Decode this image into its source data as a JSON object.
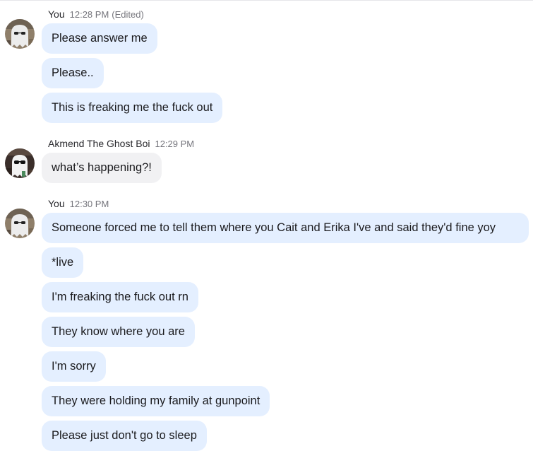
{
  "colors": {
    "mine_bubble": "#e4efff",
    "their_bubble": "#f1f1f3",
    "meta_text": "#75757c"
  },
  "groups": [
    {
      "sender": "You",
      "time": "12:28 PM",
      "edited": "(Edited)",
      "avatar": "ghost-avatar",
      "messages": [
        "Please answer me",
        "Please..",
        "This is freaking me the fuck out"
      ]
    },
    {
      "sender": "Akmend The Ghost Boi",
      "time": "12:29 PM",
      "avatar": "ghost-with-sunglasses-avatar",
      "messages": [
        "what’s happening?!"
      ]
    },
    {
      "sender": "You",
      "time": "12:30 PM",
      "avatar": "ghost-avatar",
      "messages": [
        "Someone forced me to tell them where you Cait and Erika I've and said they'd fine yoy",
        "*live",
        "I'm freaking the fuck out rn",
        "They know where you are",
        "I'm sorry",
        "They were holding my family at gunpoint",
        "Please just don't go to sleep"
      ]
    }
  ]
}
